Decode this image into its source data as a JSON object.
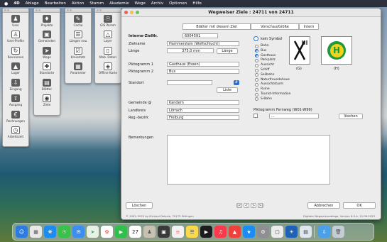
{
  "menubar": {
    "apple": "",
    "app": "4D",
    "items": [
      "Ablage",
      "Bearbeiten",
      "Aktion",
      "Stamm",
      "Akademie",
      "Wege",
      "Archiv",
      "Optionen",
      "Hilfe"
    ]
  },
  "palette1": {
    "items": [
      "User",
      "User-Profile",
      "Revisionen",
      "Lager",
      "Eingang",
      "Ausgang",
      "Rechnungen",
      "Arbeitszeit"
    ]
  },
  "palette2": {
    "items": [
      "Projekte",
      "Gemeinden",
      "Wege",
      "Standorte",
      "Blätter",
      "Ziele"
    ]
  },
  "palette3": {
    "items": [
      "Cache",
      "Längen neu",
      "Kreisstatz",
      "Parameter"
    ]
  },
  "palette4": {
    "items": [
      "GIS Param",
      "Layer",
      "Mob. Daten",
      "Offline Karte"
    ]
  },
  "window": {
    "title": "Wegweiser Ziele : 24711 von 24711"
  },
  "tabs": [
    "Blätter mit diesem Ziel",
    "Vorschau/Größe",
    "Intern"
  ],
  "form": {
    "intern_label": "Interne-ZielNr.",
    "intern_value": "6004591",
    "zielname_label": "Zielname",
    "zielname_value": "Hammerstein (Wolfschlucht)",
    "laenge_label": "Länge",
    "laenge_value": "375,0 mm",
    "laenge_button": "Länge",
    "pikto1_label": "Piktogramm 1",
    "pikto1_value": "Gasthaus (Essen)",
    "pikto2_label": "Piktogramm 2",
    "pikto2_value": "Bus",
    "standort_label": "Standort",
    "standort_value": "",
    "liste_button": "Liste",
    "gemeinde_label": "Gemeinde @",
    "gemeinde_value": "Kandern",
    "landkreis_label": "Landkreis",
    "landkreis_value": "Lörrach",
    "bezirk_label": "Reg.-bezirk",
    "bezirk_value": "Freiburg",
    "bemerkungen_label": "Bemerkungen",
    "bemerkungen_value": ""
  },
  "symbols": {
    "none_label": "kein Symbol",
    "options": [
      "Bahn",
      "Bus",
      "Gasthaus",
      "Parkplatz",
      "Aussicht",
      "Schiff",
      "Seilbahn",
      "Naturfreundehaus",
      "Aussichtsturm",
      "Ruine",
      "Tourist-Information",
      "S-Bahn"
    ],
    "selected": [
      "Bus",
      "Gasthaus"
    ],
    "icon1_caption": "(G)",
    "icon2_caption": "(H)",
    "icon1": "fork-knife-icon",
    "icon2": "bus-stop-icon",
    "h_letter": "H"
  },
  "fernweg": {
    "label": "Piktogramm Fernweg (W01-W99)",
    "select_value": "...",
    "clear_button": "löschen"
  },
  "footer": {
    "delete_button": "Löschen",
    "nav": [
      "|<",
      "<",
      ">",
      ">|"
    ],
    "cancel_button": "Abbrechen",
    "ok_button": "OK",
    "copyright": "© 1992–2023 by Michael Deisele, 79175 Ettlingen",
    "version": "Digitale Wegweiserablage, Version 6.5.A, 15.08.2023"
  },
  "dock": {
    "calendar_day": "27"
  },
  "colors": {
    "accent": "#2a6fd6",
    "bus_green": "#1e9a3c",
    "bus_yellow": "#f3d21b"
  }
}
